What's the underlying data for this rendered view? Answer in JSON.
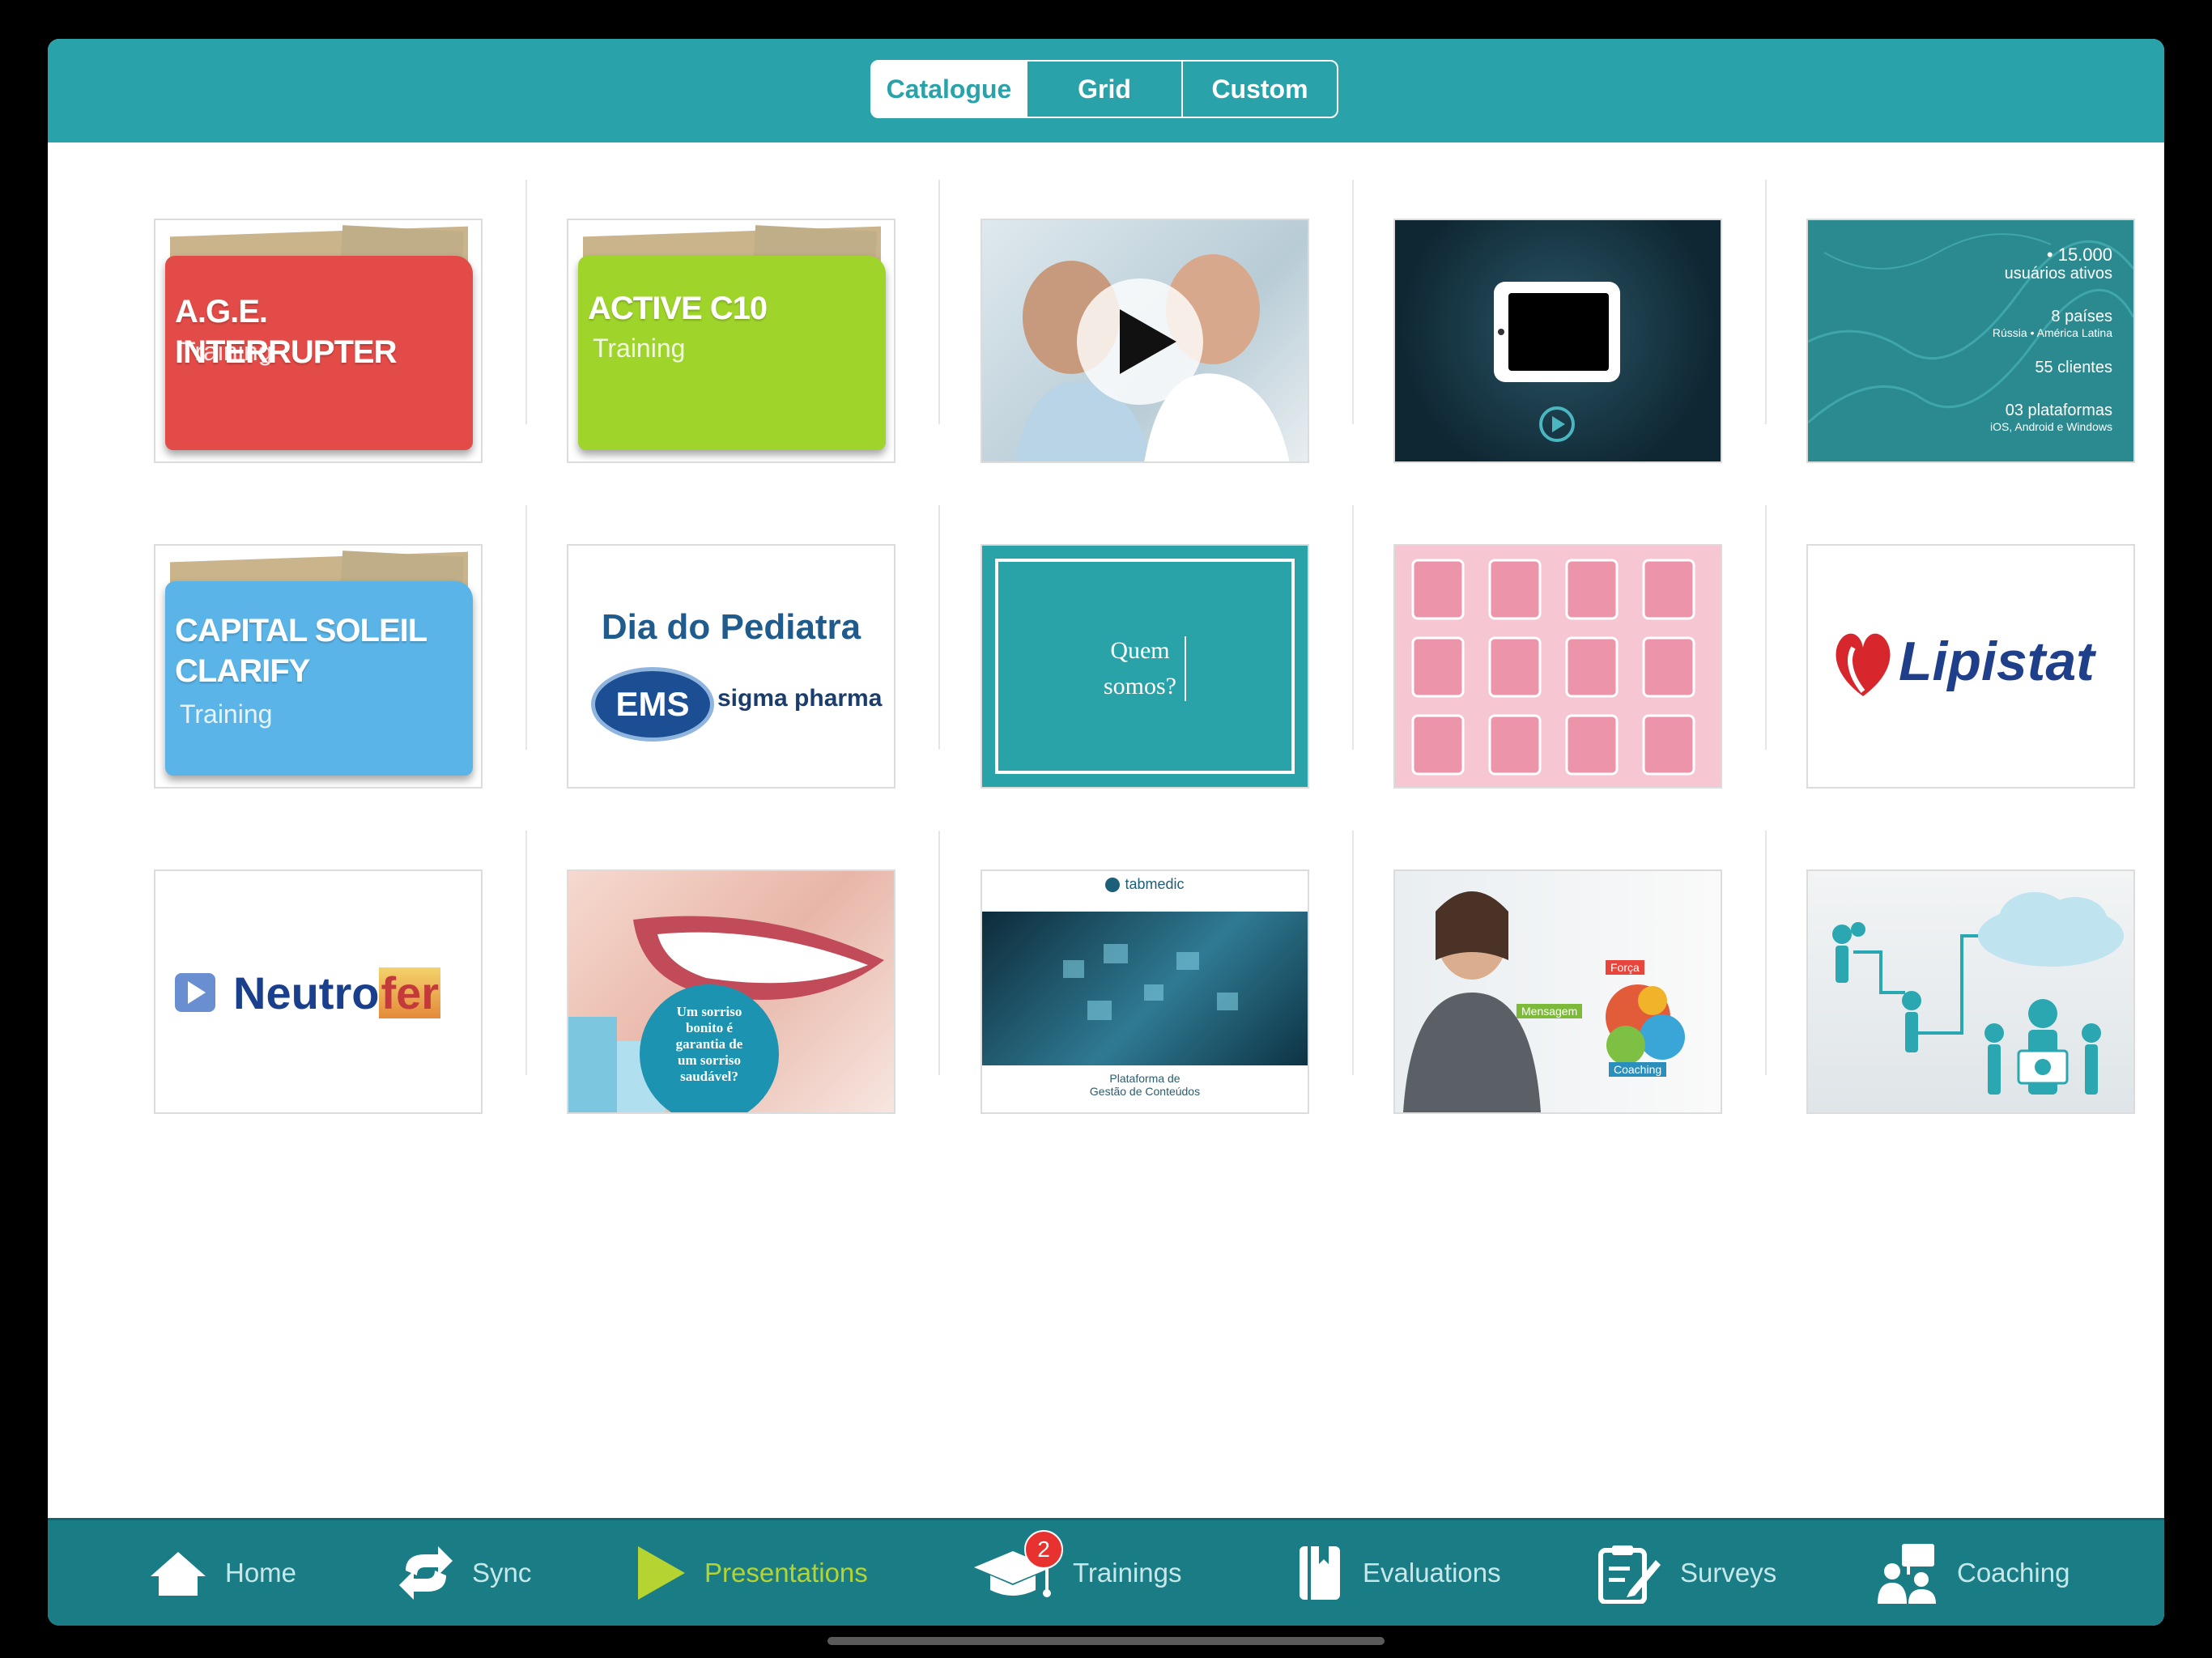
{
  "header": {
    "segments": [
      {
        "label": "Catalogue",
        "active": true
      },
      {
        "label": "Grid",
        "active": false
      },
      {
        "label": "Custom",
        "active": false
      }
    ]
  },
  "tiles": [
    {
      "type": "folder",
      "title_lines": [
        "A.G.E. INTERRUPTER"
      ],
      "subtitle": "Training",
      "color": "#e24b47"
    },
    {
      "type": "folder",
      "title_lines": [
        "ACTIVE C10"
      ],
      "subtitle": "Training",
      "color": "#9fd42a"
    },
    {
      "type": "video",
      "thumb": "doctors-video"
    },
    {
      "type": "tablet",
      "thumb": "tablet-dark"
    },
    {
      "type": "stats",
      "lines": [
        "• 15.000",
        "usuários ativos",
        "8 países",
        "Rússia • América Latina",
        "55 clientes",
        "03 plataformas",
        "iOS, Android e Windows"
      ]
    },
    {
      "type": "folder",
      "title_lines": [
        "CAPITAL SOLEIL",
        "CLARIFY"
      ],
      "subtitle": "Training",
      "color": "#5ab4e8"
    },
    {
      "type": "brand",
      "title": "Dia do Pediatra",
      "logo": "EMS",
      "tagline": "sigma pharma"
    },
    {
      "type": "teal-frame",
      "lines": [
        "Quem",
        "somos?"
      ]
    },
    {
      "type": "pattern",
      "thumb": "pink-tiles"
    },
    {
      "type": "logo",
      "text": "Lipistat"
    },
    {
      "type": "logo-neutrofer",
      "text_a": "Neutro",
      "text_b": "fer"
    },
    {
      "type": "smile",
      "lines": [
        "Um sorriso",
        "bonito é",
        "garantia de",
        "um sorriso",
        "saudável?"
      ]
    },
    {
      "type": "tech",
      "brand": "tabmedic",
      "caption_lines": [
        "Plataforma de",
        "Gestão de Conteúdos"
      ]
    },
    {
      "type": "woman",
      "labels": [
        "Força",
        "Mensagem",
        "Coaching"
      ]
    },
    {
      "type": "cloud",
      "thumb": "network-cloud"
    }
  ],
  "tabbar": {
    "items": [
      {
        "label": "Home",
        "icon": "home-icon",
        "active": false
      },
      {
        "label": "Sync",
        "icon": "sync-icon",
        "active": false
      },
      {
        "label": "Presentations",
        "icon": "play-icon",
        "active": true
      },
      {
        "label": "Trainings",
        "icon": "graduation-cap-icon",
        "active": false,
        "badge": "2"
      },
      {
        "label": "Evaluations",
        "icon": "book-icon",
        "active": false
      },
      {
        "label": "Surveys",
        "icon": "clipboard-icon",
        "active": false
      },
      {
        "label": "Coaching",
        "icon": "group-icon",
        "active": false
      }
    ]
  },
  "colors": {
    "header": "#29a2aa",
    "tabbar": "#1a7d86",
    "tab_active": "#b5d331",
    "tab_inactive": "#c6e8ea",
    "badge": "#e8322f"
  }
}
